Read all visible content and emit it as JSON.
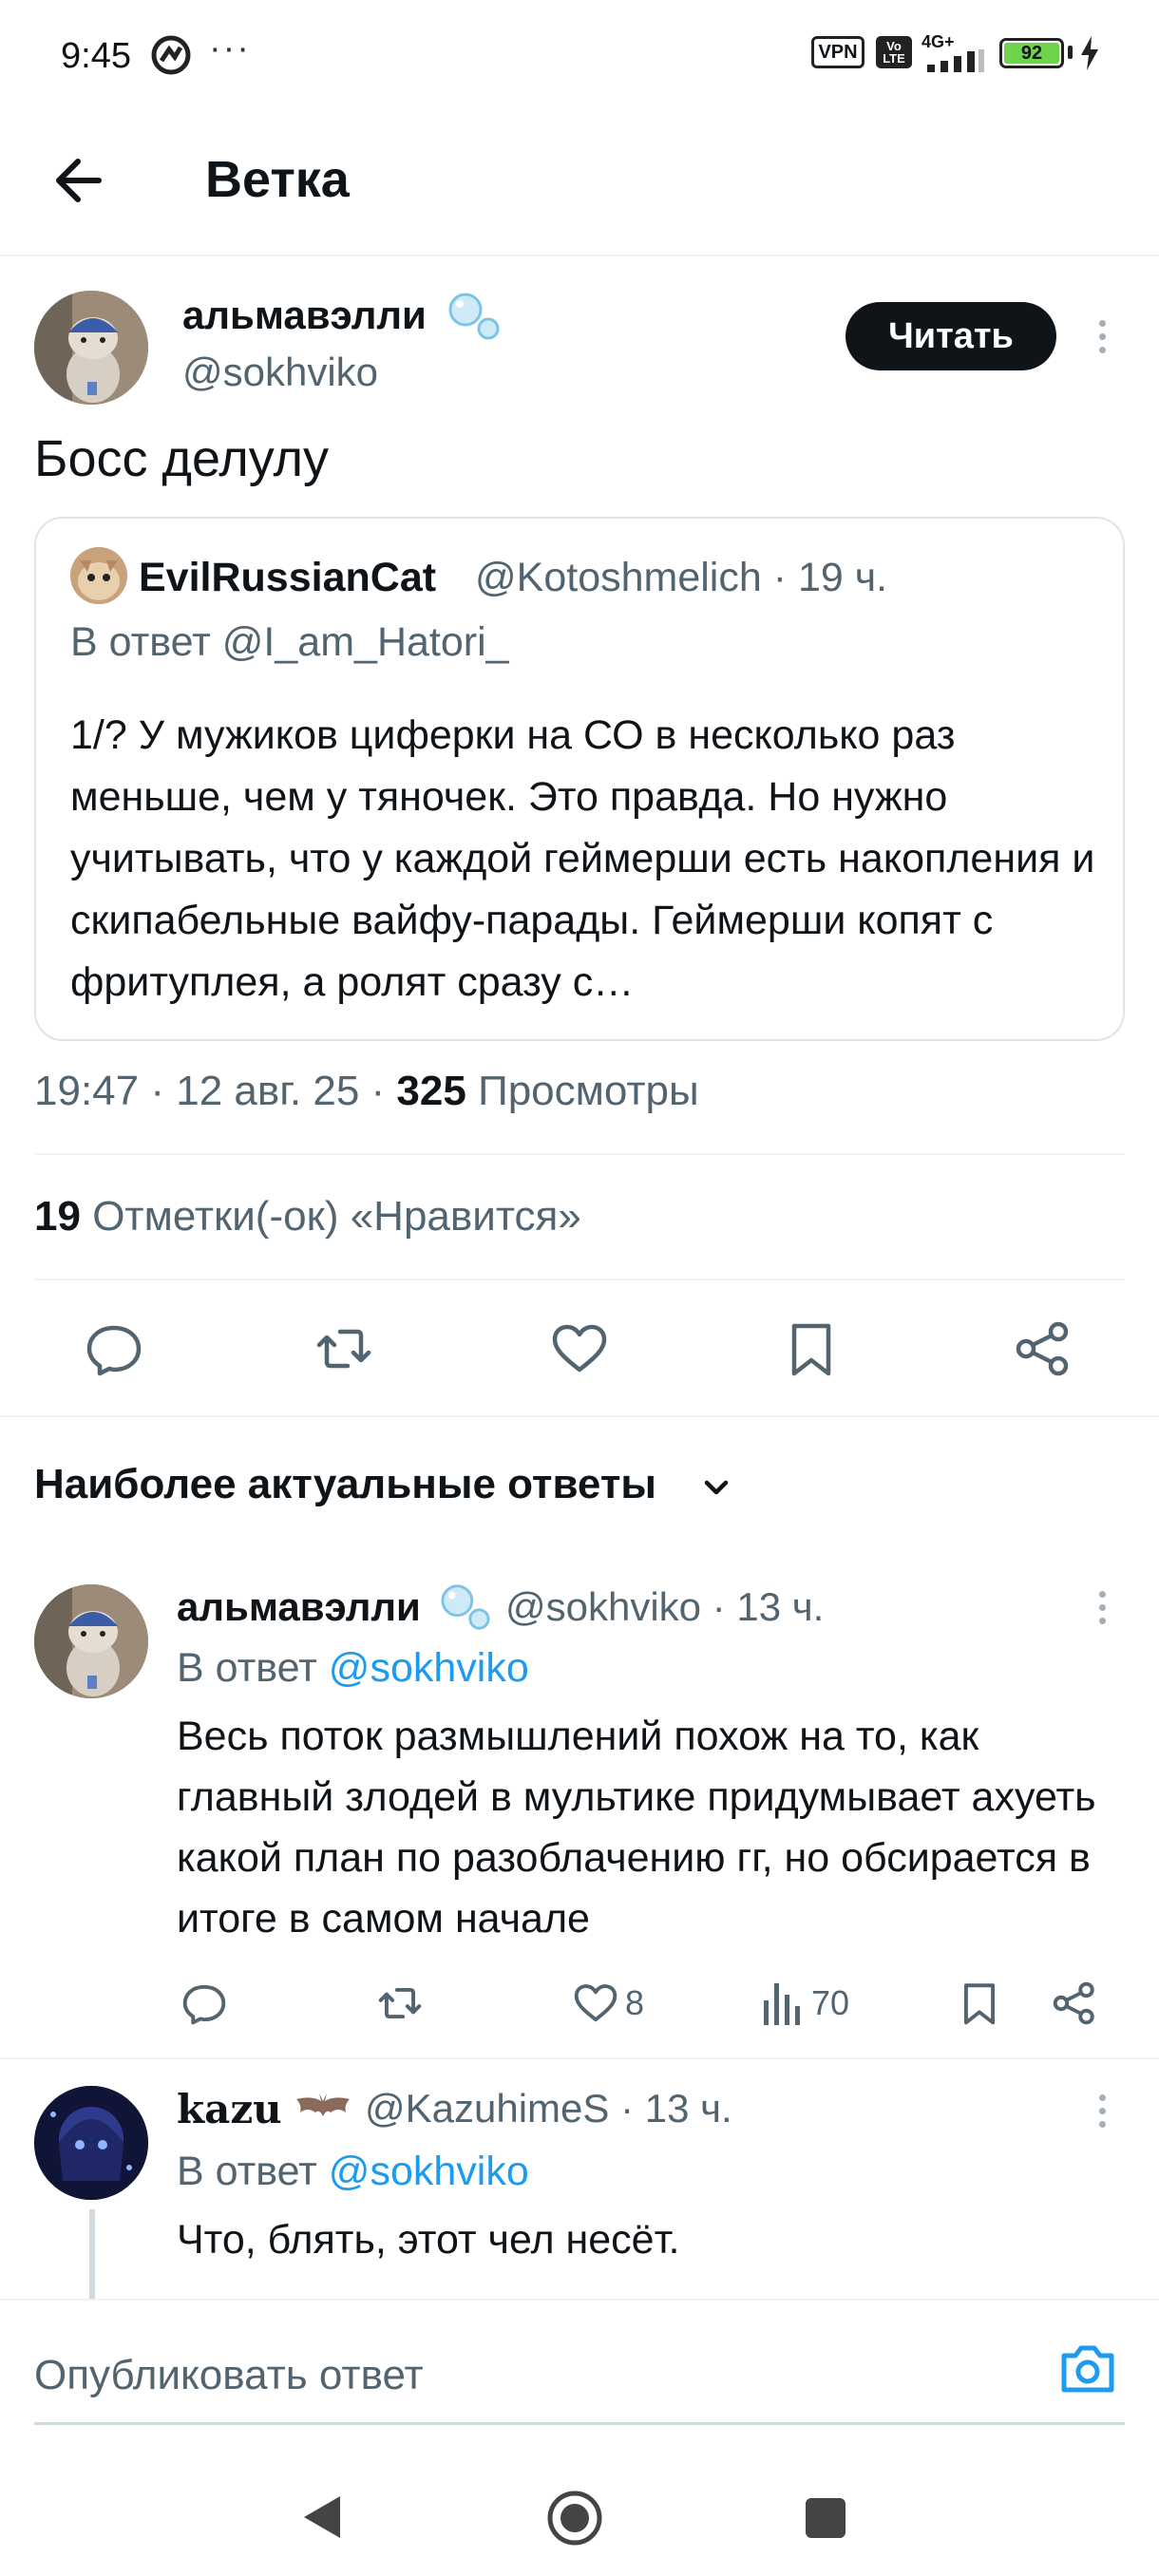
{
  "status_bar": {
    "time": "9:45",
    "overflow": "···",
    "vpn": "VPN",
    "volte": "Vo LTE",
    "network": "4G+",
    "battery": "92"
  },
  "header": {
    "title": "Ветка"
  },
  "main_tweet": {
    "author_name": "альмавэлли",
    "author_emoji": "bubbles-icon",
    "handle": "@sokhviko",
    "follow_label": "Читать",
    "text": "Босс делулу",
    "quote": {
      "author_name": "EvilRussianCat",
      "meta": "@Kotoshmelich · 19 ч.",
      "reply_to": "В ответ @I_am_Hatori_",
      "body": "1/? У мужиков циферки на СО в несколько раз меньше, чем у тяночек. Это правда. Но нужно учитывать, что у каждой геймерши есть накопления и скипабельные вайфу-парады. Геймерши копят с фритуплея, а ролят сразу с…"
    },
    "time": "19:47",
    "date": "12 авг. 25",
    "views_count": "325",
    "views_label": "Просмотры",
    "likes_count": "19",
    "likes_label": "Отметки(-ок) «Нравится»"
  },
  "sort": {
    "label": "Наиболее актуальные ответы"
  },
  "replies": [
    {
      "author_name": "альмавэлли",
      "meta": "@sokhviko · 13 ч.",
      "reply_prefix": "В ответ",
      "reply_handle": "@sokhviko",
      "body": "Весь поток размышлений похож на то, как главный злодей в мультике придумывает ахуеть какой план по разоблачению гг, но обсирается в итоге в самом начале",
      "likes": "8",
      "views": "70"
    },
    {
      "author_name": "kazu",
      "meta": "@KazuhimeS · 13 ч.",
      "reply_prefix": "В ответ",
      "reply_handle": "@sokhviko",
      "body": "Что, блять, этот чел несёт."
    }
  ],
  "compose": {
    "placeholder": "Опубликовать ответ"
  },
  "colors": {
    "accent": "#1d9bf0",
    "text": "#0f1419",
    "secondary": "#536471",
    "divider": "#eff3f4"
  }
}
